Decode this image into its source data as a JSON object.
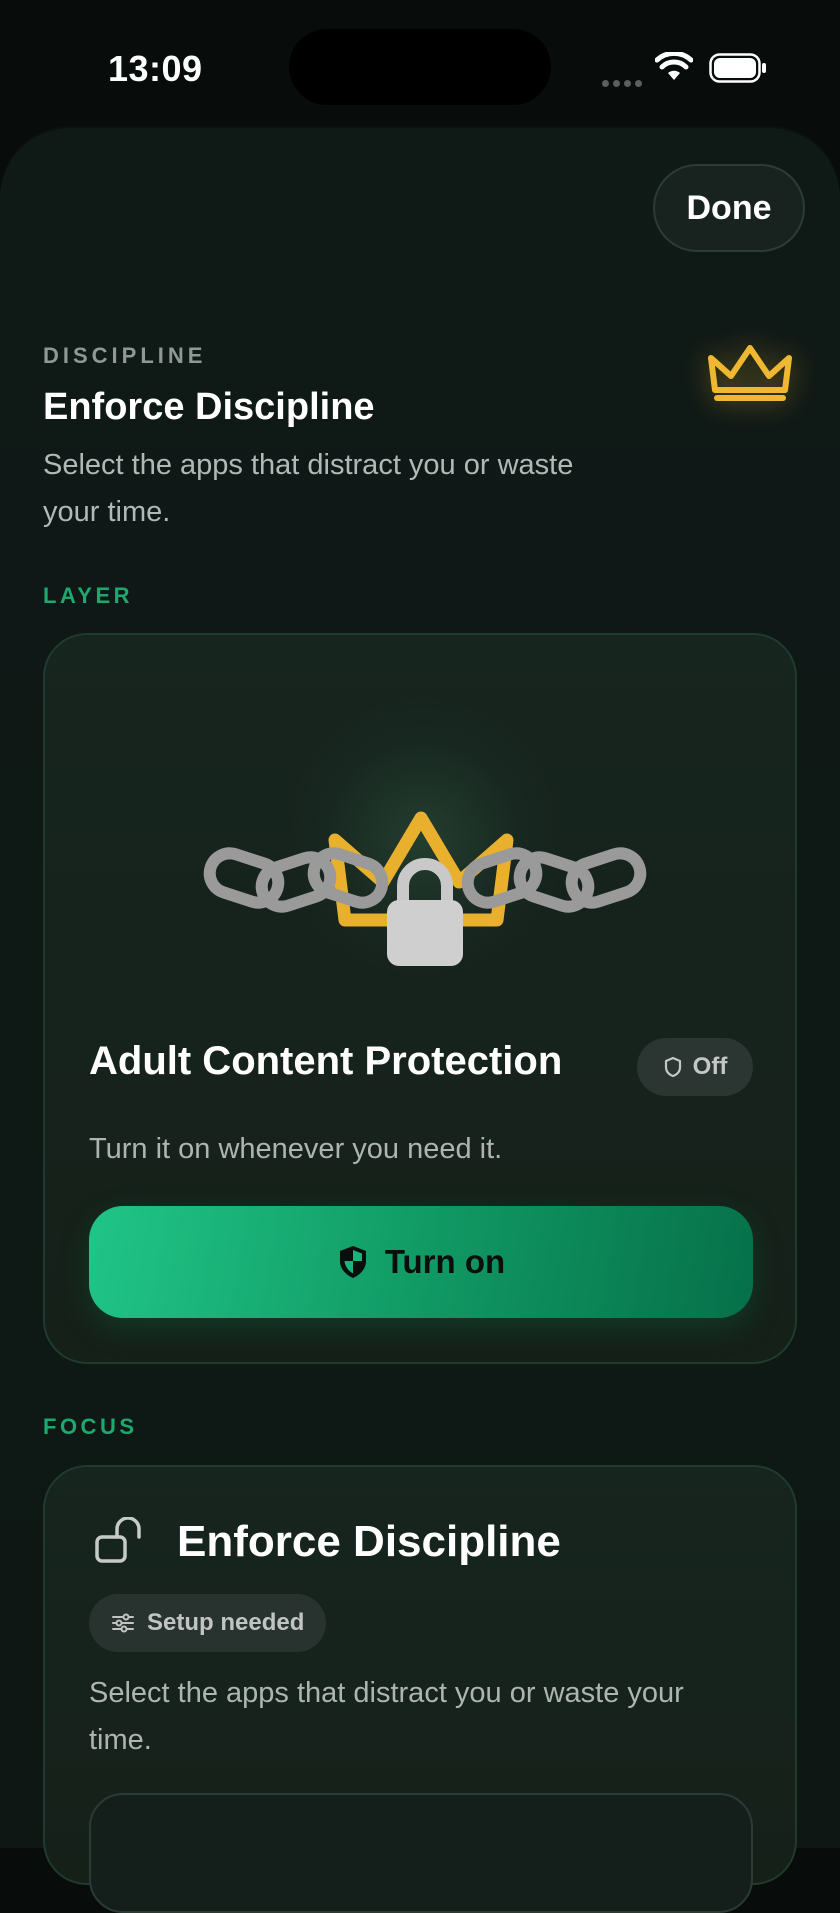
{
  "status_bar": {
    "time": "13:09"
  },
  "header": {
    "done_label": "Done"
  },
  "intro": {
    "eyebrow": "DISCIPLINE",
    "title": "Enforce Discipline",
    "description": "Select the apps that distract you or waste your time."
  },
  "layer_section": {
    "label": "LAYER",
    "card": {
      "title": "Adult Content Protection",
      "status": "Off",
      "description": "Turn it on whenever you need it.",
      "button_label": "Turn on"
    }
  },
  "focus_section": {
    "label": "FOCUS",
    "card": {
      "title": "Enforce Discipline",
      "badge": "Setup needed",
      "description": "Select the apps that distract you or waste your time."
    }
  },
  "colors": {
    "accent_green": "#1ea86e",
    "button_gradient_start": "#20c587",
    "button_gradient_end": "#06704a",
    "crown_gold": "#f0b830",
    "background": "#080c0b"
  },
  "icons": [
    "wifi-icon",
    "battery-icon",
    "crown-icon",
    "chain-lock-crown-illustration",
    "shield-icon",
    "shield-half-icon",
    "unlock-icon",
    "sliders-icon"
  ]
}
